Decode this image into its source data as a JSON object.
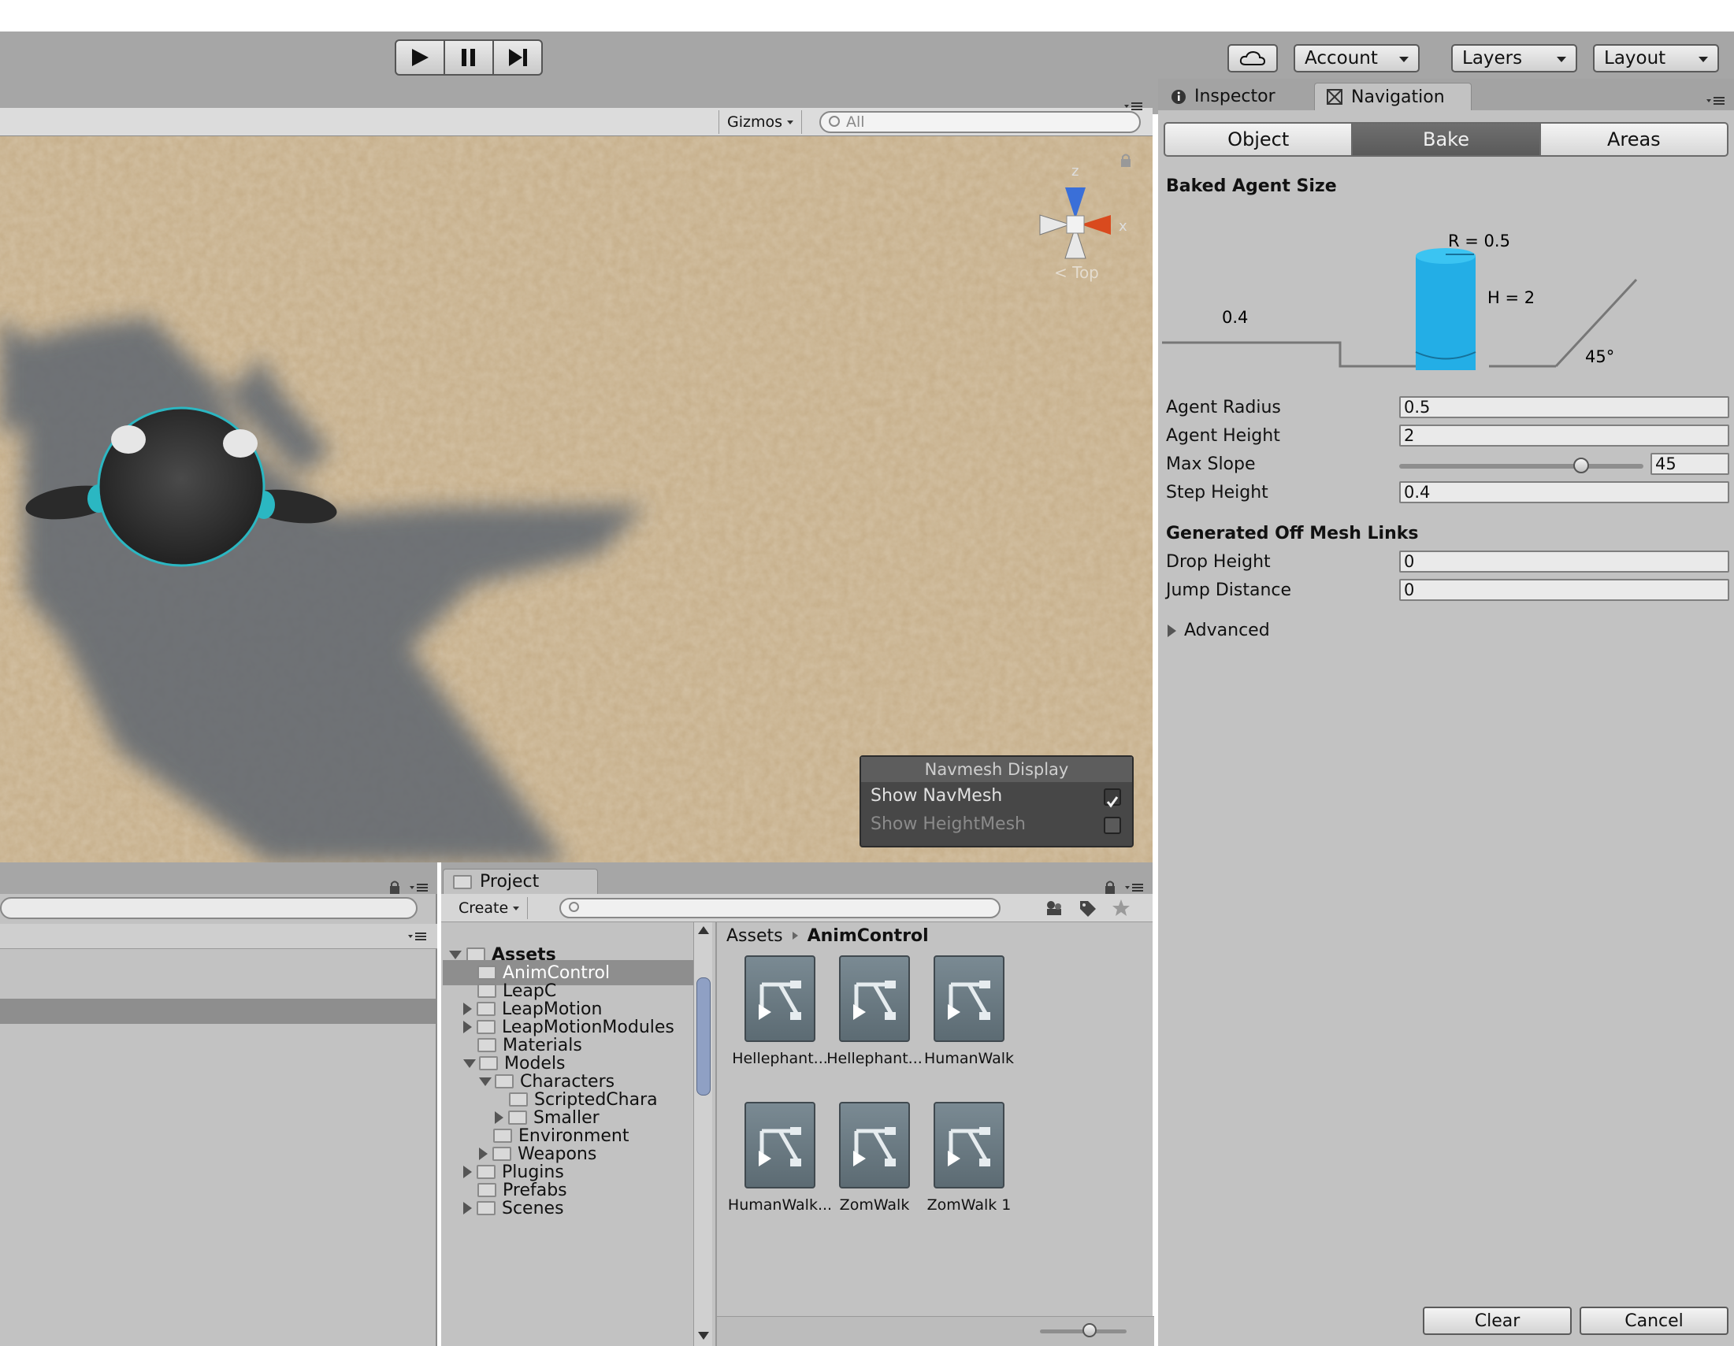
{
  "toolbar": {
    "account_label": "Account",
    "layers_label": "Layers",
    "layout_label": "Layout",
    "play_icon": "play-icon",
    "pause_icon": "pause-icon",
    "step_icon": "step-icon",
    "cloud_icon": "cloud-icon"
  },
  "scene": {
    "gizmos_label": "Gizmos",
    "search_placeholder": "All",
    "orientation_label": "Top",
    "axis_labels": {
      "z": "z",
      "x": "x"
    },
    "navmesh_display": {
      "title": "Navmesh Display",
      "show_navmesh_label": "Show NavMesh",
      "show_navmesh_checked": true,
      "show_heightmesh_label": "Show HeightMesh",
      "show_heightmesh_checked": false
    }
  },
  "inspector": {
    "tab_inspector": "Inspector",
    "tab_navigation": "Navigation",
    "segments": [
      "Object",
      "Bake",
      "Areas"
    ],
    "selected_segment": "Bake",
    "baked_agent_size_title": "Baked Agent Size",
    "diagram": {
      "radius_label": "R = 0.5",
      "height_label": "H = 2",
      "step_label": "0.4",
      "slope_label": "45°"
    },
    "agent_radius_label": "Agent Radius",
    "agent_radius_value": "0.5",
    "agent_height_label": "Agent Height",
    "agent_height_value": "2",
    "max_slope_label": "Max Slope",
    "max_slope_value": "45",
    "max_slope_fraction": 0.75,
    "step_height_label": "Step Height",
    "step_height_value": "0.4",
    "offmesh_title": "Generated Off Mesh Links",
    "drop_height_label": "Drop Height",
    "drop_height_value": "0",
    "jump_distance_label": "Jump Distance",
    "jump_distance_value": "0",
    "advanced_label": "Advanced",
    "clear_label": "Clear",
    "cancel_label": "Cancel"
  },
  "project": {
    "tab_label": "Project",
    "create_label": "Create",
    "breadcrumb_root": "Assets",
    "breadcrumb_current": "AnimControl",
    "tree": [
      {
        "label": "Assets",
        "bold": true,
        "expanded": true
      },
      {
        "label": "AnimControl",
        "selected": true
      },
      {
        "label": "LeapC"
      },
      {
        "label": "LeapMotion",
        "collapsed": true
      },
      {
        "label": "LeapMotionModules",
        "collapsed": true
      },
      {
        "label": "Materials"
      },
      {
        "label": "Models",
        "expanded": true
      },
      {
        "label": "Characters",
        "expanded": true
      },
      {
        "label": "ScriptedChara"
      },
      {
        "label": "Smaller",
        "collapsed": true
      },
      {
        "label": "Environment"
      },
      {
        "label": "Weapons",
        "collapsed": true
      },
      {
        "label": "Plugins",
        "collapsed": true
      },
      {
        "label": "Prefabs"
      },
      {
        "label": "Scenes",
        "collapsed": true
      }
    ],
    "assets": [
      "Hellephant...",
      "Hellephant...",
      "HumanWalk",
      "HumanWalk...",
      "ZomWalk",
      "ZomWalk 1"
    ]
  }
}
